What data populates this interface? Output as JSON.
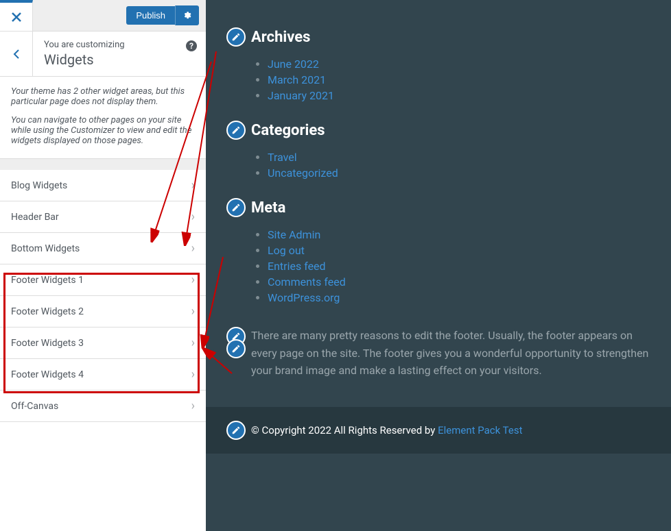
{
  "publish_label": "Publish",
  "customizing_label": "You are customizing",
  "panel_title": "Widgets",
  "description_p1": "Your theme has 2 other widget areas, but this particular page does not display them.",
  "description_p2": "You can navigate to other pages on your site while using the Customizer to view and edit the widgets displayed on those pages.",
  "widget_areas": [
    "Blog Widgets",
    "Header Bar",
    "Bottom Widgets",
    "Footer Widgets 1",
    "Footer Widgets 2",
    "Footer Widgets 3",
    "Footer Widgets 4",
    "Off-Canvas"
  ],
  "preview": {
    "archives_title": "Archives",
    "archives": [
      "June 2022",
      "March 2021",
      "January 2021"
    ],
    "categories_title": "Categories",
    "categories": [
      "Travel",
      "Uncategorized"
    ],
    "meta_title": "Meta",
    "meta": [
      "Site Admin",
      "Log out",
      "Entries feed",
      "Comments feed",
      "WordPress.org"
    ],
    "paragraph": "There are many pretty reasons to edit the footer. Usually, the footer appears on every page on the site. The footer gives you a wonderful opportunity to strengthen your brand image and make a lasting effect on your visitors.",
    "copyright_pre": "© Copyright 2022 All Rights Reserved by ",
    "copyright_link": "Element Pack Test"
  }
}
